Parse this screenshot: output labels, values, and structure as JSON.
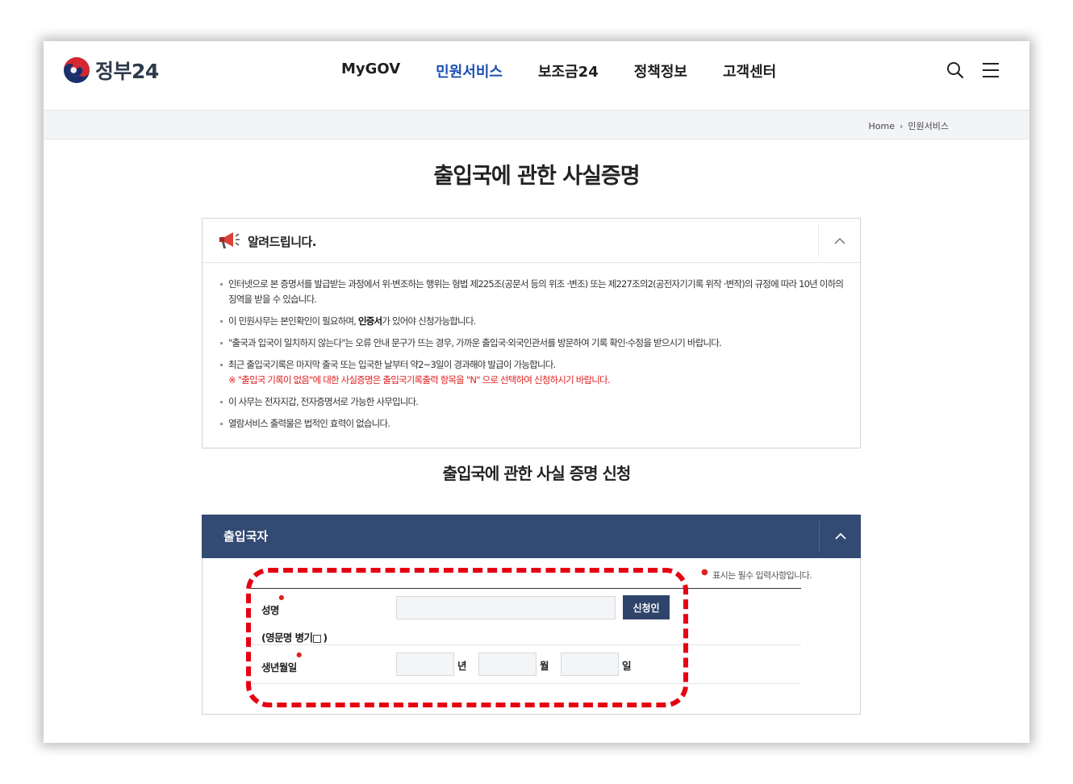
{
  "header": {
    "logo_text": "정부24",
    "nav": [
      "MyGOV",
      "민원서비스",
      "보조금24",
      "정책정보",
      "고객센터"
    ],
    "active_nav": "민원서비스",
    "search_icon": "search-icon",
    "menu_icon": "hamburger-menu-icon"
  },
  "breadcrumb": {
    "home": "Home",
    "current": "민원서비스"
  },
  "page_title": "출입국에 관한 사실증명",
  "notice": {
    "title": "알려드립니다.",
    "item1": "인터넷으로 본 증명서를 발급받는 과정에서 위·변조하는 행위는 형법 제225조(공문서 등의 위조 ·변조) 또는 제227조의2(공전자기기록 위작 ·변작)의 규정에 따라 10년 이하의 징역을 받을 수 있습니다.",
    "item2_pre": "이 민원사무는 본인확인이 필요하며, ",
    "item2_strong": "인증서",
    "item2_post": "가 있어야 신청가능합니다.",
    "item3": "\"출국과 입국이 일치하지 않는다\"는 오류 안내 문구가 뜨는 경우, 가까운 출입국·외국인관서를 방문하여 기록 확인·수정을 받으시기 바랍니다.",
    "item4": "최근 출입국기록은 마지막 출국 또는 입국한 날부터 약2~3일이 경과해야 발급이 가능합니다.",
    "item4_red": "※ \"출입국 기록이 없음\"에 대한 사실증명은 출입국기록출력 항목을 \"N\" 으로 선택하여 신청하시기 바랍니다.",
    "item5": "이 사무는 전자지갑, 전자증명서로 가능한 사무입니다.",
    "item6": "열람서비스 출력물은 법적인 효력이 없습니다."
  },
  "sub_title": "출입국에 관한 사실 증명 신청",
  "form": {
    "section_title": "출입국자",
    "required_note": "표시는 필수 입력사항입니다.",
    "name_label": "성명",
    "name_value": "",
    "apply_button": "신청인",
    "english_label_pre": "(영문명 병기",
    "english_label_post": ")",
    "birth_label": "생년월일",
    "year_unit": "년",
    "month_unit": "월",
    "day_unit": "일",
    "year_value": "",
    "month_value": "",
    "day_value": ""
  },
  "colors": {
    "accent": "#1b4fb3",
    "form_header": "#334a73",
    "button": "#2f446b",
    "highlight": "#e60012",
    "required": "#e02020"
  }
}
